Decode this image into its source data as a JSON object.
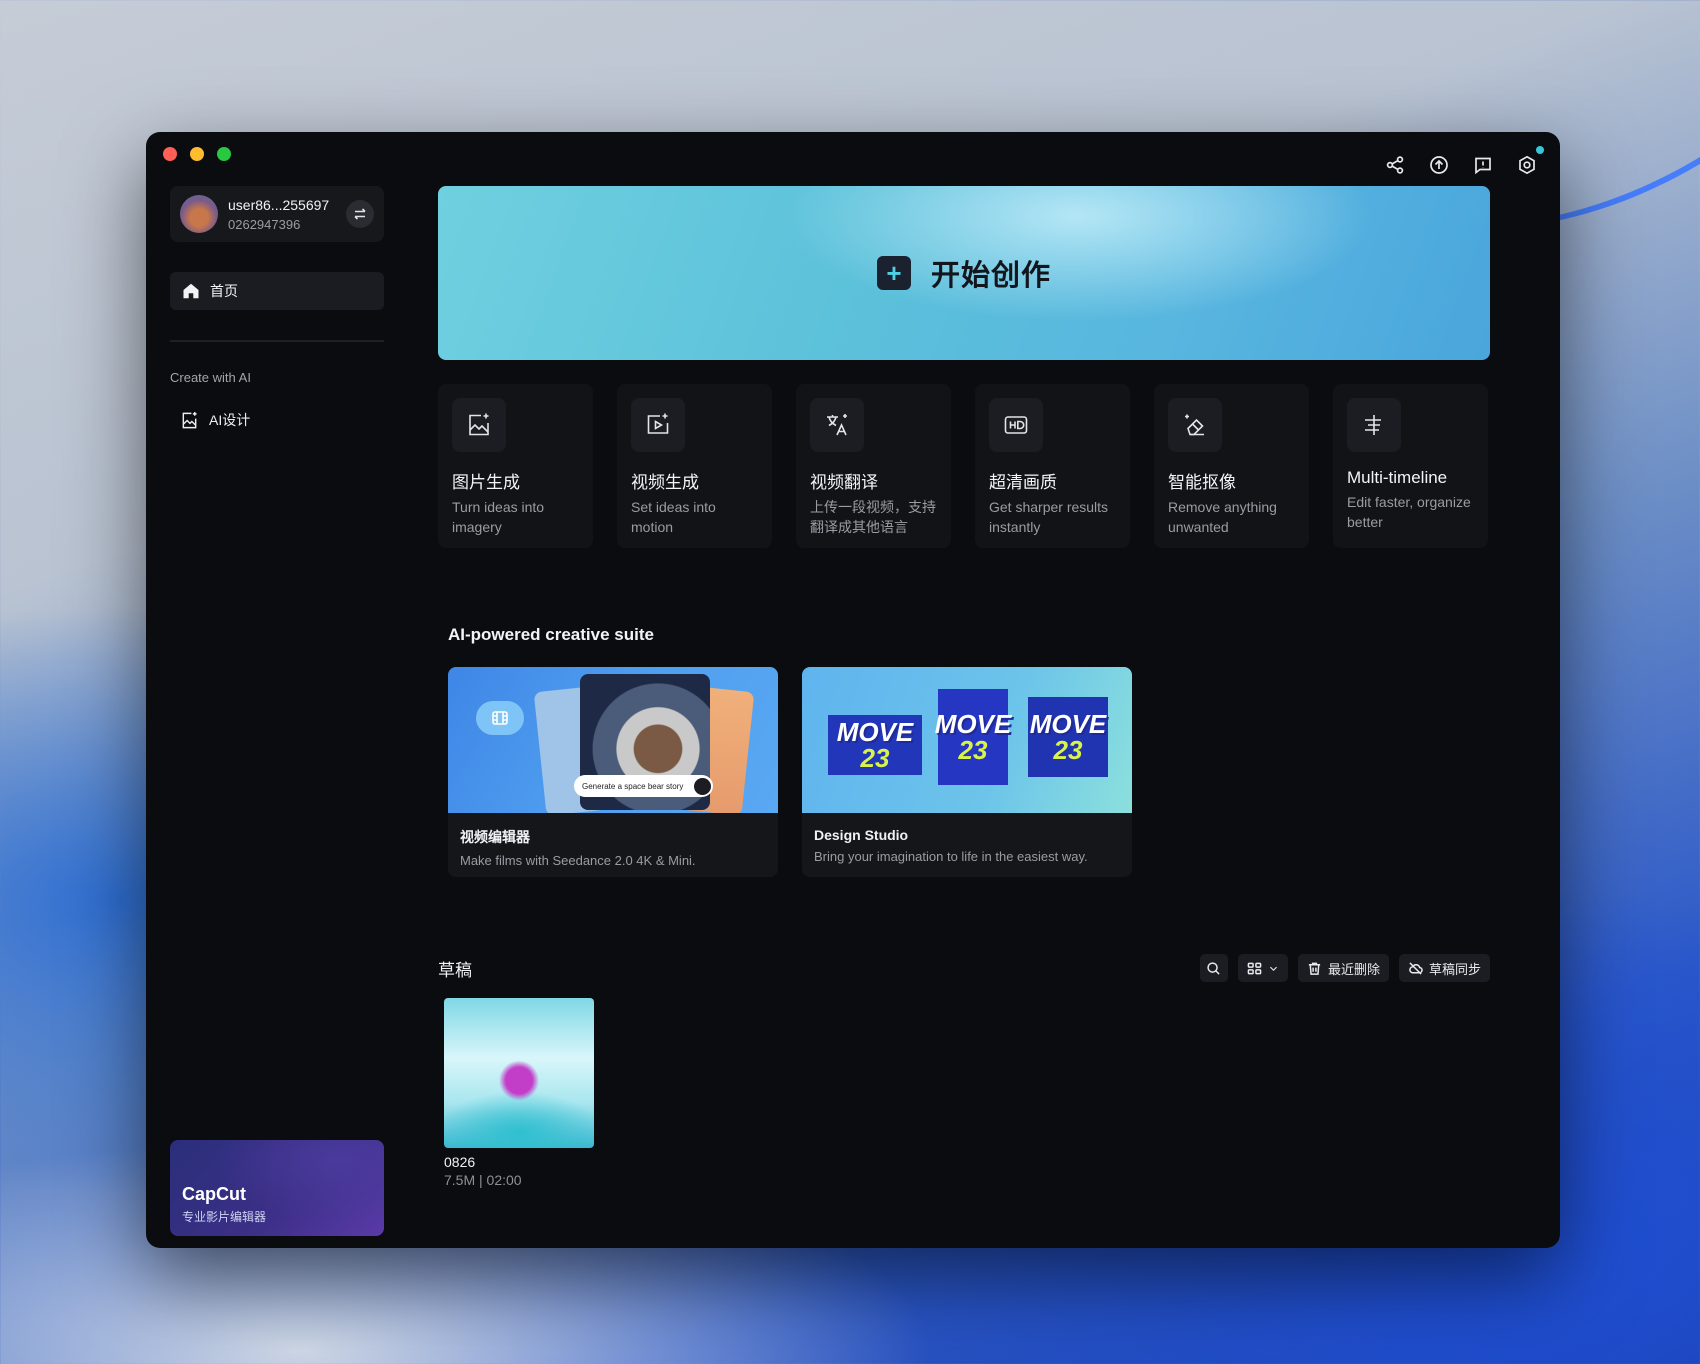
{
  "account": {
    "name": "user86...255697",
    "id": "0262947396"
  },
  "nav": {
    "home": "首页"
  },
  "sidebar": {
    "section_label": "Create with AI",
    "ai_design": "AI设计"
  },
  "promo": {
    "title": "CapCut",
    "subtitle": "专业影片编辑器"
  },
  "hero": {
    "label": "开始创作"
  },
  "tools": [
    {
      "title": "图片生成",
      "desc": "Turn ideas into imagery"
    },
    {
      "title": "视频生成",
      "desc": "Set ideas into motion"
    },
    {
      "title": "视频翻译",
      "desc": "上传一段视频，支持翻译成其他语言"
    },
    {
      "title": "超清画质",
      "desc": "Get sharper results instantly"
    },
    {
      "title": "智能抠像",
      "desc": "Remove anything unwanted"
    },
    {
      "title": "Multi-timeline",
      "desc": "Edit faster, organize better"
    }
  ],
  "suite": {
    "title": "AI-powered creative suite",
    "cards": [
      {
        "title": "视频编辑器",
        "desc": "Make films with Seedance 2.0 4K & Mini.",
        "prompt": "Generate a space bear story"
      },
      {
        "title": "Design Studio",
        "desc": "Bring your imagination to life in the easiest way.",
        "tile_text": "MOVE",
        "tile_num": "23"
      }
    ]
  },
  "drafts": {
    "title": "草稿",
    "recent_deleted": "最近删除",
    "sync": "草稿同步",
    "items": [
      {
        "name": "0826",
        "meta": "7.5M | 02:00"
      }
    ]
  }
}
